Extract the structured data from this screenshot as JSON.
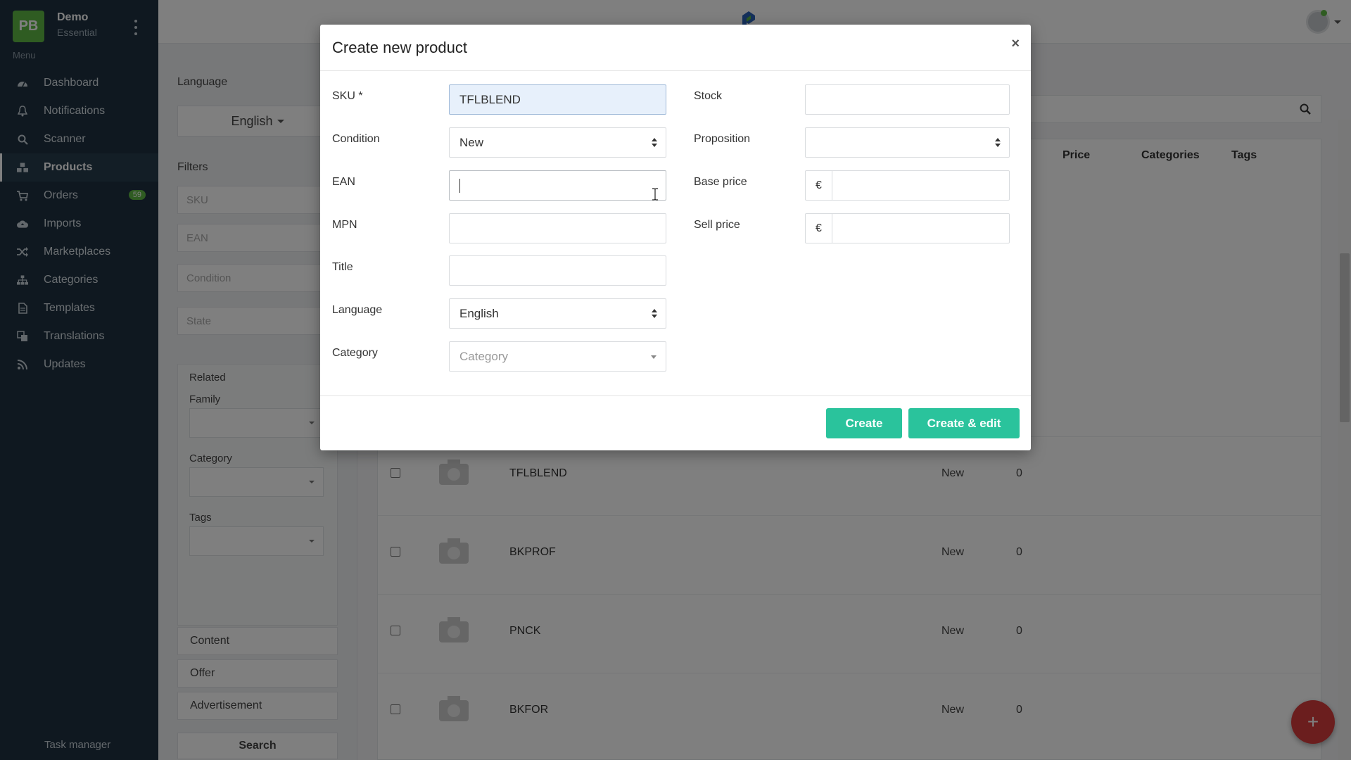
{
  "sidebar": {
    "brand_initials": "PB",
    "account_name": "Demo",
    "account_plan": "Essential",
    "menu_caption": "Menu",
    "items": [
      {
        "label": "Dashboard",
        "icon": "dashboard-icon"
      },
      {
        "label": "Notifications",
        "icon": "bell-icon"
      },
      {
        "label": "Scanner",
        "icon": "search-icon"
      },
      {
        "label": "Products",
        "icon": "boxes-icon",
        "active": true
      },
      {
        "label": "Orders",
        "icon": "cart-icon",
        "badge": "59"
      },
      {
        "label": "Imports",
        "icon": "cloud-upload-icon"
      },
      {
        "label": "Marketplaces",
        "icon": "shuffle-icon"
      },
      {
        "label": "Categories",
        "icon": "sitemap-icon"
      },
      {
        "label": "Templates",
        "icon": "file-icon"
      },
      {
        "label": "Translations",
        "icon": "language-icon"
      },
      {
        "label": "Updates",
        "icon": "rss-icon"
      }
    ],
    "task_manager": "Task manager"
  },
  "filters": {
    "language_label": "Language",
    "language_value": "English",
    "filters_label": "Filters",
    "sku_placeholder": "SKU",
    "ean_placeholder": "EAN",
    "condition_placeholder": "Condition",
    "state_placeholder": "State",
    "related_label": "Related",
    "family_label": "Family",
    "category_label": "Category",
    "tags_label": "Tags",
    "content_label": "Content",
    "offer_label": "Offer",
    "advertisement_label": "Advertisement",
    "search_button": "Search"
  },
  "table": {
    "headers": {
      "price": "Price",
      "categories": "Categories",
      "tags": "Tags"
    },
    "rows": [
      {
        "sku": "TFLBLEND",
        "condition": "New",
        "stock": "0"
      },
      {
        "sku": "BKPROF",
        "condition": "New",
        "stock": "0"
      },
      {
        "sku": "PNCK",
        "condition": "New",
        "stock": "0"
      },
      {
        "sku": "BKFOR",
        "condition": "New",
        "stock": "0"
      }
    ]
  },
  "fab_label": "+",
  "modal": {
    "title": "Create new product",
    "close": "×",
    "sku_label": "SKU *",
    "sku_value": "TFLBLEND",
    "condition_label": "Condition",
    "condition_value": "New",
    "ean_label": "EAN",
    "ean_value": "",
    "mpn_label": "MPN",
    "title_label": "Title",
    "language_label": "Language",
    "language_value": "English",
    "category_label": "Category",
    "category_placeholder": "Category",
    "stock_label": "Stock",
    "proposition_label": "Proposition",
    "base_price_label": "Base price",
    "sell_price_label": "Sell price",
    "currency_symbol": "€",
    "create_button": "Create",
    "create_edit_button": "Create & edit"
  },
  "colors": {
    "sidebar_bg": "#1e3140",
    "brand_green": "#5fb944",
    "primary_button": "#2ac39c",
    "fab_red": "#d63c3c"
  }
}
